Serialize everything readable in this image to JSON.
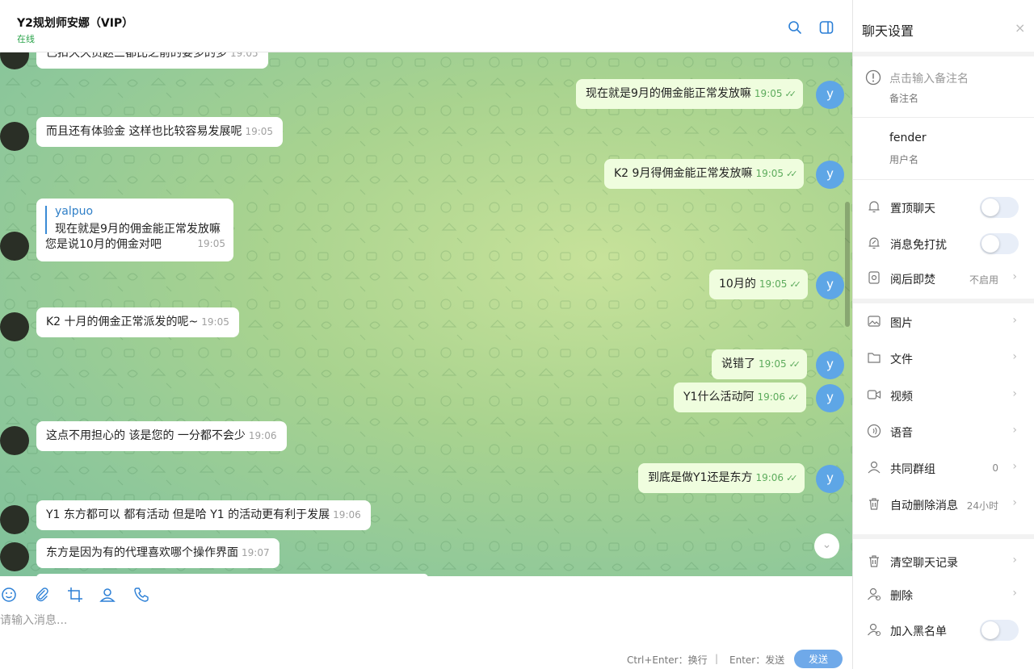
{
  "header": {
    "title": "Y2规划师安娜（VIP）",
    "status": "在线",
    "search_icon": "search-icon",
    "panel_icon": "sidebar-toggle-icon"
  },
  "messages": [
    {
      "dir": "in",
      "text": "已扣久久员赵三都比之前的要多的多",
      "time": "19:05"
    },
    {
      "dir": "out",
      "text": "现在就是9月的佣金能正常发放嘛",
      "time": "19:05",
      "avatar": "y"
    },
    {
      "dir": "in",
      "text": "而且还有体验金  这样也比较容易发展呢",
      "time": "19:05"
    },
    {
      "dir": "out",
      "text": "K2 9月得佣金能正常发放嘛",
      "time": "19:05",
      "avatar": "y"
    },
    {
      "dir": "in",
      "quote": {
        "name": "yalpuo",
        "text": "现在就是9月的佣金能正常发放嘛"
      },
      "text": "您是说10月的佣金对吧",
      "time": "19:05"
    },
    {
      "dir": "out",
      "text": "10月的",
      "time": "19:05",
      "avatar": "y"
    },
    {
      "dir": "in",
      "text": "K2 十月的佣金正常派发的呢~",
      "time": "19:05"
    },
    {
      "dir": "out",
      "text": "说错了",
      "time": "19:05",
      "avatar": "y"
    },
    {
      "dir": "out",
      "text": "Y1什么活动阿",
      "time": "19:06",
      "avatar": "y"
    },
    {
      "dir": "in",
      "text": "这点不用担心的   该是您的  一分都不会少",
      "time": "19:06"
    },
    {
      "dir": "out",
      "text": "到底是做Y1还是东方",
      "time": "19:06",
      "avatar": "y"
    },
    {
      "dir": "in",
      "text": "Y1  东方都可以  都有活动   但是哈 Y1 的活动更有利于发展",
      "time": "19:06"
    },
    {
      "dir": "in",
      "text": "东方是因为有的代理喜欢哪个操作界面",
      "time": "19:07"
    }
  ],
  "composer": {
    "placeholder": "请输入消息...",
    "hint_ctrl": "Ctrl+Enter：换行",
    "hint_sep": "|",
    "hint_enter": "Enter：发送",
    "send_label": "发送",
    "tools": [
      "emoji-icon",
      "attach-icon",
      "crop-icon",
      "contact-icon",
      "phone-icon"
    ]
  },
  "settings": {
    "title": "聊天设置",
    "close": "×",
    "remark_placeholder": "点击输入备注名",
    "remark_label": "备注名",
    "username": "fender",
    "username_label": "用户名",
    "pin_chat": "置顶聊天",
    "mute": "消息免打扰",
    "burn_after_read": "阅后即焚",
    "burn_value": "不启用",
    "images": "图片",
    "files": "文件",
    "videos": "视频",
    "voice": "语音",
    "common_groups": "共同群组",
    "common_groups_count": "0",
    "auto_delete": "自动删除消息",
    "auto_delete_value": "24小时",
    "clear_history": "清空聊天记录",
    "delete": "删除",
    "block": "加入黑名单",
    "toggles": {
      "pin_chat": false,
      "mute": false,
      "block": false
    }
  }
}
